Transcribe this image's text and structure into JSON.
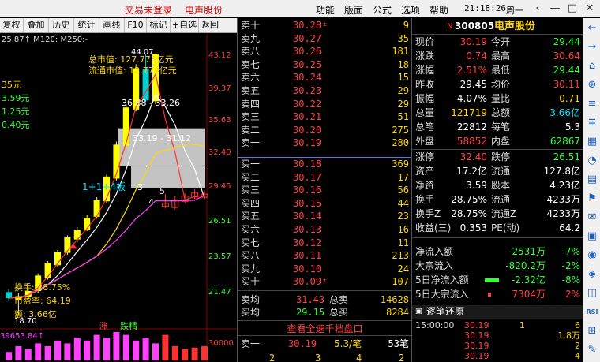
{
  "topbar": {
    "trade_status": "交易未登录",
    "stock_name": "电声股份",
    "menu": [
      "功能",
      "版面",
      "公式",
      "选项",
      "帮助"
    ],
    "time": "21:18:26",
    "weekday": "周一"
  },
  "toolbar": {
    "items": [
      "复权",
      "叠加",
      "历史",
      "统计",
      "画线",
      "F10",
      "标记",
      "+自选",
      "返回"
    ]
  },
  "chart": {
    "ma_line": "25.87↑  M120:  M250:-",
    "market_value_total": "总市值: 127.773亿元",
    "market_value_float": "流通市值: 12.779亿元",
    "left_values": [
      "35元",
      "3.59元",
      "1.25元",
      "0.40元"
    ],
    "annotation_top": "44.07",
    "range1": "36.88 - 33.26",
    "range2": "33.19 - 31.12",
    "board_label": "1+1+4板",
    "counts": [
      "3",
      "5",
      "4"
    ],
    "turnover": "换手: 28.75%",
    "pe": "市盈率: 64.19",
    "amount": "额: 3.66亿",
    "low_mark": "18.70",
    "volume_mark": "39653.84↑",
    "tags": [
      "涨",
      "跌精"
    ],
    "axis_labels": [
      "43.12",
      "39.37",
      "35.63",
      "32.40",
      "29.45",
      "26.51",
      "23.57",
      "21.47"
    ],
    "vol_axis": "30000",
    "colors": {
      "up": "#ff3030",
      "down": "#00d0d0",
      "ma5": "#ffffff",
      "ma10": "#ffd700",
      "ma20": "#ff40ff",
      "ma60": "#33ff33"
    }
  },
  "chart_data": {
    "type": "candlestick",
    "x": [
      "1",
      "2",
      "3",
      "4",
      "5",
      "6",
      "7",
      "8",
      "9",
      "10",
      "11",
      "12",
      "13",
      "14",
      "15",
      "16",
      "17",
      "18",
      "19",
      "20",
      "21"
    ],
    "open": [
      21.0,
      20.2,
      20.5,
      21.1,
      22.4,
      23.6,
      24.8,
      26.1,
      27.0,
      28.3,
      29.8,
      32.0,
      35.2,
      38.7,
      42.6,
      39.5,
      29.3,
      29.2,
      29.8,
      30.2,
      30.5
    ],
    "close": [
      20.4,
      20.6,
      21.1,
      22.6,
      23.8,
      24.9,
      26.3,
      27.0,
      28.2,
      29.9,
      32.2,
      35.3,
      38.9,
      42.7,
      39.6,
      44.1,
      29.6,
      29.9,
      30.3,
      30.6,
      30.19
    ],
    "high": [
      21.3,
      20.9,
      21.4,
      22.8,
      24.0,
      25.1,
      26.5,
      27.3,
      28.5,
      30.2,
      32.4,
      35.6,
      39.2,
      43.1,
      44.07,
      44.07,
      30.5,
      30.3,
      30.6,
      31.0,
      30.9
    ],
    "low": [
      20.1,
      18.7,
      20.3,
      20.9,
      22.2,
      23.4,
      24.6,
      25.8,
      26.9,
      28.1,
      29.6,
      31.8,
      35.0,
      38.5,
      39.4,
      39.2,
      29.1,
      29.0,
      29.6,
      30.0,
      30.0
    ]
  },
  "quotes": {
    "sell": [
      {
        "label": "卖十",
        "price": "30.28",
        "tag": "±",
        "vol": "9"
      },
      {
        "label": "卖九",
        "price": "30.27",
        "tag": "",
        "vol": "35"
      },
      {
        "label": "卖八",
        "price": "30.26",
        "tag": "",
        "vol": "181"
      },
      {
        "label": "卖七",
        "price": "30.25",
        "tag": "",
        "vol": "18"
      },
      {
        "label": "卖六",
        "price": "30.24",
        "tag": "",
        "vol": "15"
      },
      {
        "label": "卖五",
        "price": "30.23",
        "tag": "",
        "vol": "29"
      },
      {
        "label": "卖四",
        "price": "30.22",
        "tag": "",
        "vol": "29"
      },
      {
        "label": "卖三",
        "price": "30.21",
        "tag": "",
        "vol": "51"
      },
      {
        "label": "卖二",
        "price": "30.20",
        "tag": "",
        "vol": "275"
      },
      {
        "label": "卖一",
        "price": "30.19",
        "tag": "",
        "vol": "280"
      }
    ],
    "buy": [
      {
        "label": "买一",
        "price": "30.18",
        "tag": "",
        "vol": "369"
      },
      {
        "label": "买二",
        "price": "30.17",
        "tag": "",
        "vol": "17"
      },
      {
        "label": "买三",
        "price": "30.16",
        "tag": "",
        "vol": "56"
      },
      {
        "label": "买四",
        "price": "30.15",
        "tag": "",
        "vol": "44"
      },
      {
        "label": "买五",
        "price": "30.14",
        "tag": "",
        "vol": "23"
      },
      {
        "label": "买六",
        "price": "30.13",
        "tag": "",
        "vol": "16"
      },
      {
        "label": "买七",
        "price": "30.12",
        "tag": "",
        "vol": "11"
      },
      {
        "label": "买八",
        "price": "30.11",
        "tag": "",
        "vol": "213"
      },
      {
        "label": "买九",
        "price": "30.10",
        "tag": "",
        "vol": "24"
      },
      {
        "label": "买十",
        "price": "30.09",
        "tag": "±",
        "vol": "107"
      }
    ],
    "avg_sell_label": "卖均",
    "avg_sell": "31.43",
    "total_sell_label": "总卖",
    "total_sell": "14628",
    "avg_buy_label": "买均",
    "avg_buy": "29.15",
    "total_buy_label": "总买",
    "total_buy": "8284",
    "view_all": "查看全速千档盘口",
    "bottom_label": "卖一",
    "bottom_price": "30.19",
    "bottom_rate": "5.3/笔",
    "bottom_count": "53笔",
    "bottom_nums": [
      "2",
      "3",
      "4",
      "2"
    ]
  },
  "info": {
    "code_prefix": "N",
    "code": "300805",
    "name": "电声股份",
    "rows": [
      {
        "l1": "现价",
        "v1": "30.19",
        "c1": "red",
        "l2": "今开",
        "v2": "29.44",
        "c2": "grn"
      },
      {
        "l1": "涨跌",
        "v1": "0.74",
        "c1": "red",
        "l2": "最高",
        "v2": "30.64",
        "c2": "red"
      },
      {
        "l1": "涨幅",
        "v1": "2.51%",
        "c1": "red",
        "l2": "最低",
        "v2": "29.44",
        "c2": "grn"
      },
      {
        "l1": "昨收",
        "v1": "29.45",
        "c1": "wht",
        "l2": "均价",
        "v2": "30.11",
        "c2": "red"
      },
      {
        "l1": "振幅",
        "v1": "4.07%",
        "c1": "wht",
        "l2": "量比",
        "v2": "0.71",
        "c2": "yel"
      },
      {
        "l1": "总量",
        "v1": "121719",
        "c1": "yel",
        "l2": "总额",
        "v2": "3.66亿",
        "c2": "cyn"
      },
      {
        "l1": "总笔",
        "v1": "22812",
        "c1": "wht",
        "l2": "每笔",
        "v2": "5.3",
        "c2": "wht"
      },
      {
        "l1": "外盘",
        "v1": "58852",
        "c1": "red",
        "l2": "内盘",
        "v2": "62867",
        "c2": "grn"
      },
      {
        "l1": "涨停",
        "v1": "32.40",
        "c1": "red",
        "l2": "跌停",
        "v2": "26.51",
        "c2": "grn"
      },
      {
        "l1": "资产",
        "v1": "17.2亿",
        "c1": "wht",
        "l2": "流通",
        "v2": "127.8亿",
        "c2": "wht"
      },
      {
        "l1": "净资",
        "v1": "3.59",
        "c1": "wht",
        "l2": "股本",
        "v2": "4.23亿",
        "c2": "wht"
      },
      {
        "l1": "换手",
        "v1": "28.75%",
        "c1": "wht",
        "l2": "流通",
        "v2": "4233万",
        "c2": "wht"
      },
      {
        "l1": "换手Z",
        "v1": "28.75%",
        "c1": "wht",
        "l2": "流通Z",
        "v2": "4233万",
        "c2": "wht"
      },
      {
        "l1": "收益(三)",
        "v1": "0.353",
        "c1": "wht",
        "l2": "PE(动)",
        "v2": "64.2",
        "c2": "wht"
      }
    ],
    "flows": [
      {
        "label": "净流入额",
        "val": "-2531万",
        "pct": "-7%",
        "color": "grn"
      },
      {
        "label": "大宗流入",
        "val": "-820.2万",
        "pct": "-2%",
        "color": "grn"
      },
      {
        "label": "5日净流入额",
        "val": "-2.32亿",
        "pct": "-8%",
        "color": "grn"
      },
      {
        "label": "5日大宗流入",
        "val": "7304万",
        "pct": "2%",
        "color": "red"
      }
    ],
    "tick_header": "逐笔还原",
    "ticks": [
      {
        "time": "15:00:00",
        "price": "30.19",
        "n": "1",
        "v": "6"
      },
      {
        "time": "",
        "price": "30.19",
        "n": "",
        "v": "1.8万"
      },
      {
        "time": "",
        "price": "30.19",
        "n": "",
        "v": "2"
      },
      {
        "time": "",
        "price": "30.19",
        "n": "",
        "v": "4"
      },
      {
        "time": "",
        "price": "30.19",
        "n": "",
        "v": "14"
      }
    ]
  },
  "sidebar": {
    "icons": [
      "←",
      "→",
      "⌂",
      "⊕",
      "≡",
      "≣",
      "▦",
      "◔",
      "▤",
      "⚑",
      "✉",
      "▣",
      "◉",
      "◈",
      "◫",
      "RSI",
      "⊞",
      "✎"
    ]
  }
}
